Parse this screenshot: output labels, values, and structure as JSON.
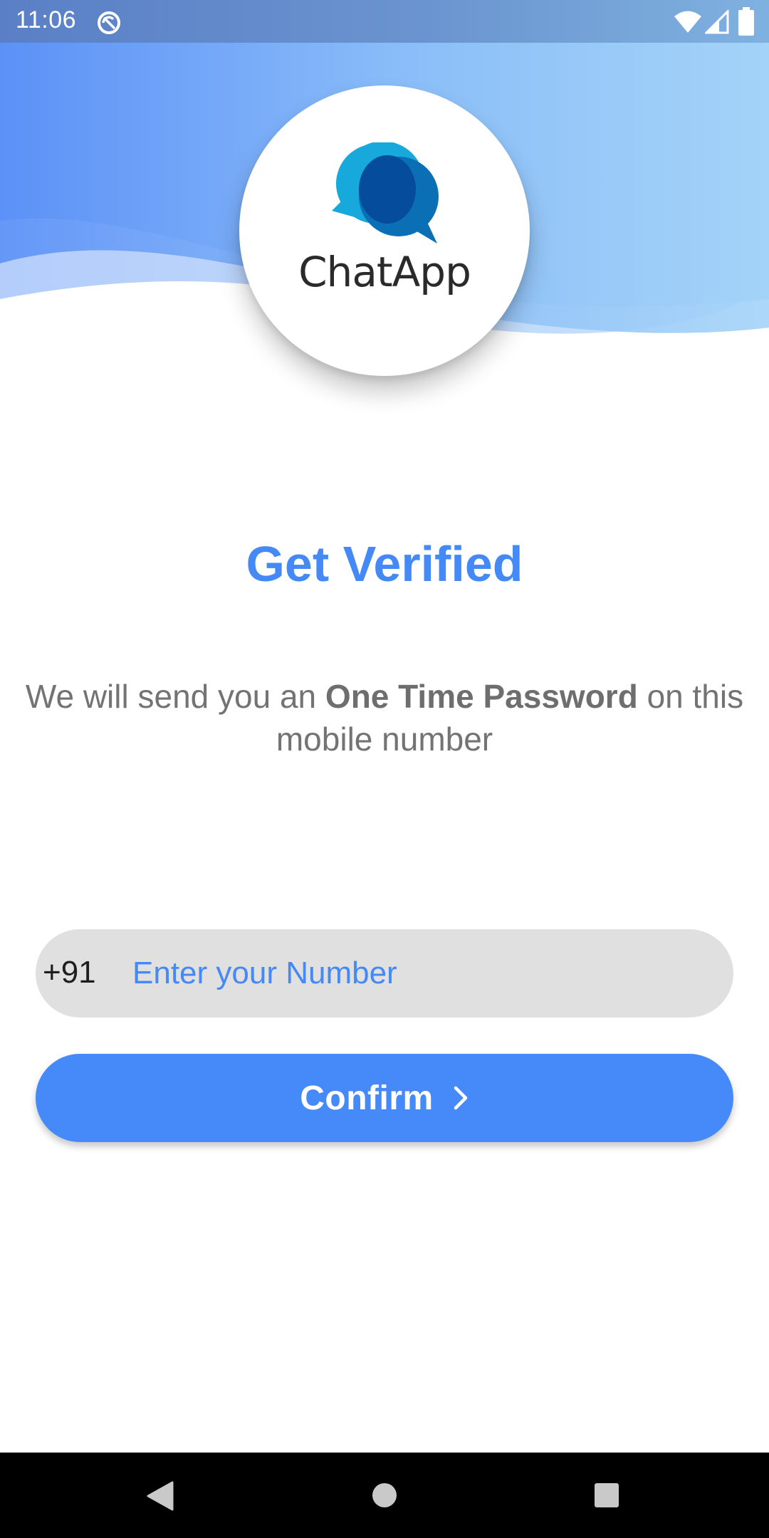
{
  "status_bar": {
    "time": "11:06",
    "icons": [
      "sync-icon",
      "wifi-icon",
      "signal-icon",
      "battery-icon"
    ]
  },
  "header": {
    "logo_text": "ChatApp",
    "logo_icon": "chat-bubbles-icon",
    "gradient_colors": [
      "#5a8ff6",
      "#8ec2f8",
      "#a6d5f8"
    ]
  },
  "main": {
    "title": "Get Verified",
    "description": {
      "before": "We will send you an ",
      "emphasis": "One Time Password",
      "after": " on this mobile number"
    }
  },
  "phone_field": {
    "country_code": "+91",
    "placeholder": "Enter your Number",
    "value": ""
  },
  "confirm_button": {
    "label": "Confirm",
    "icon": "chevron-right-icon"
  },
  "nav_bar": {
    "icons": [
      "back-icon",
      "home-icon",
      "recents-icon"
    ]
  },
  "colors": {
    "accent": "#4489f6",
    "button": "#468af9",
    "field_background": "#e0e0e0",
    "description_text": "#737373"
  }
}
